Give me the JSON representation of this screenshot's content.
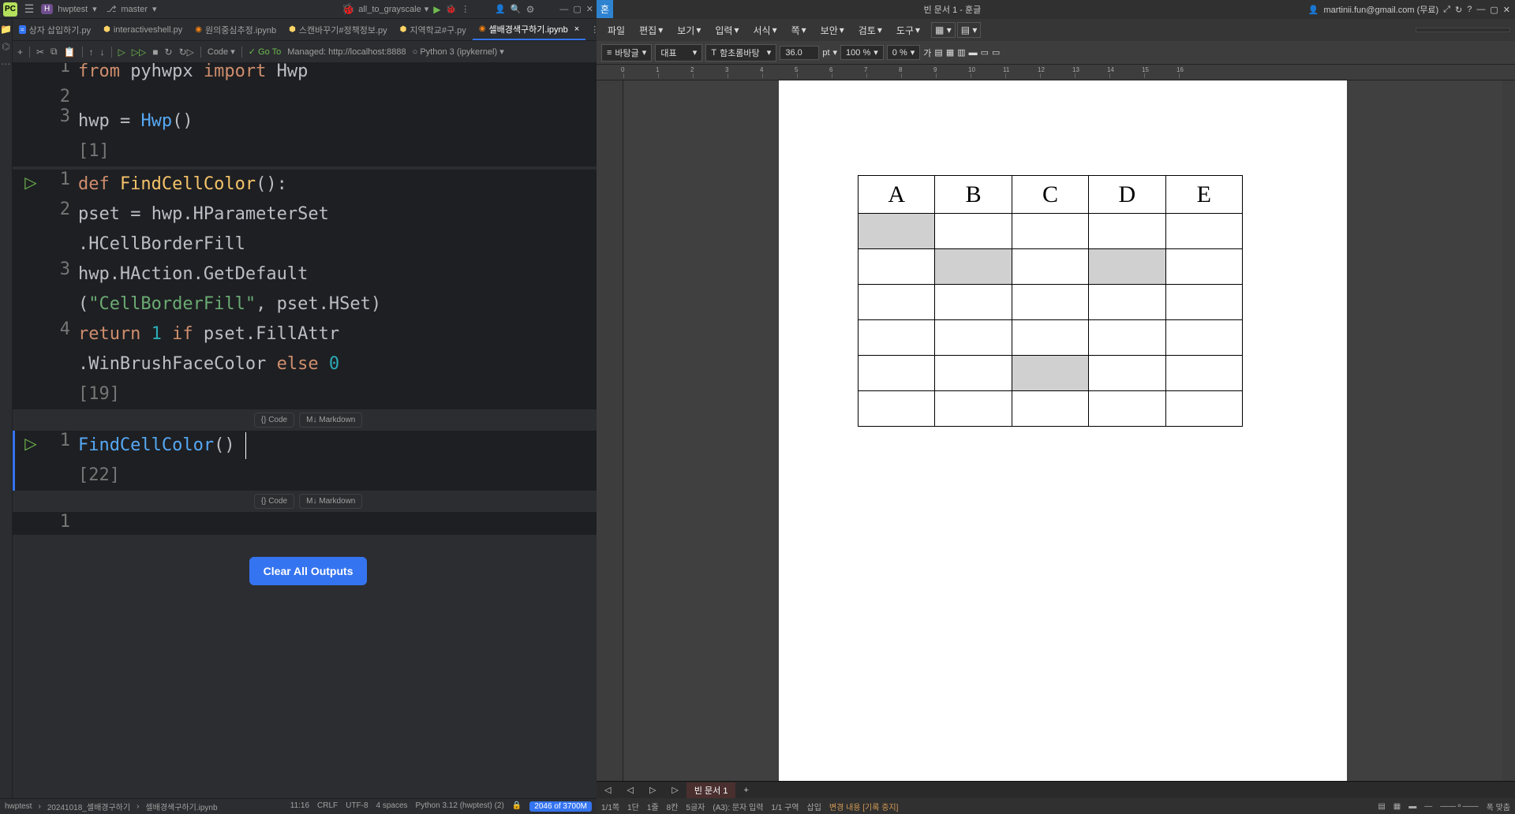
{
  "pycharm": {
    "project": "hwptest",
    "branch": "master",
    "config": "all_to_grayscale",
    "tabs": [
      {
        "label": "상자 삽입하기.py",
        "icon": "blue"
      },
      {
        "label": "interactiveshell.py",
        "icon": "py"
      },
      {
        "label": "원의중심추정.ipynb",
        "icon": "jp"
      },
      {
        "label": "스캔바꾸기#정책정보.py",
        "icon": "py"
      },
      {
        "label": "지역학교#구.py",
        "icon": "py"
      },
      {
        "label": "셀배경색구하기.ipynb",
        "icon": "jp",
        "active": true
      }
    ],
    "toolbar": {
      "code": "Code",
      "goto": "Go To",
      "managed": "Managed: http://localhost:8888",
      "kernel": "Python 3 (ipykernel)"
    },
    "cells": [
      {
        "exec": "[1]",
        "lines": [
          {
            "n": "1",
            "frag": [
              {
                "t": "from ",
                "c": "kw"
              },
              {
                "t": "pyhwpx ",
                "c": "id"
              },
              {
                "t": "import ",
                "c": "kw"
              },
              {
                "t": "Hwp",
                "c": "id"
              }
            ]
          },
          {
            "n": "2",
            "frag": []
          },
          {
            "n": "3",
            "frag": [
              {
                "t": "hwp ",
                "c": "id"
              },
              {
                "t": "= ",
                "c": "op"
              },
              {
                "t": "Hwp",
                "c": "fn"
              },
              {
                "t": "()",
                "c": "op"
              }
            ]
          }
        ]
      },
      {
        "exec": "[19]",
        "run": true,
        "lines": [
          {
            "n": "1",
            "frag": [
              {
                "t": "def ",
                "c": "kw"
              },
              {
                "t": "FindCellColor",
                "c": "fname"
              },
              {
                "t": "():",
                "c": "op"
              }
            ]
          },
          {
            "n": "2",
            "frag": [
              {
                "t": "    pset ",
                "c": "id"
              },
              {
                "t": "= ",
                "c": "op"
              },
              {
                "t": "hwp.HParameterSet",
                "c": "id"
              }
            ]
          },
          {
            "n": "",
            "frag": [
              {
                "t": "      .HCellBorderFill",
                "c": "id"
              }
            ]
          },
          {
            "n": "3",
            "frag": [
              {
                "t": "    hwp.HAction.GetDefault",
                "c": "id"
              }
            ]
          },
          {
            "n": "",
            "frag": [
              {
                "t": "      (",
                "c": "op"
              },
              {
                "t": "\"CellBorderFill\"",
                "c": "str"
              },
              {
                "t": ", pset.HSet)",
                "c": "id"
              }
            ]
          },
          {
            "n": "4",
            "frag": [
              {
                "t": "    ",
                "c": "id"
              },
              {
                "t": "return ",
                "c": "kw"
              },
              {
                "t": "1 ",
                "c": "num"
              },
              {
                "t": "if ",
                "c": "kw"
              },
              {
                "t": "pset.FillAttr",
                "c": "id"
              }
            ]
          },
          {
            "n": "",
            "frag": [
              {
                "t": "      .WinBrushFaceColor ",
                "c": "id"
              },
              {
                "t": "else ",
                "c": "kw"
              },
              {
                "t": "0",
                "c": "num"
              }
            ]
          }
        ]
      },
      {
        "exec": "[22]",
        "run": true,
        "focused": true,
        "lines": [
          {
            "n": "1",
            "frag": [
              {
                "t": "FindCellColor",
                "c": "fn"
              },
              {
                "t": "()",
                "c": "op"
              }
            ]
          }
        ]
      },
      {
        "exec": "",
        "lines": [
          {
            "n": "1",
            "frag": []
          }
        ]
      }
    ],
    "addcell": {
      "code": "Code",
      "markdown": "Markdown"
    },
    "clear": "Clear All Outputs",
    "status": {
      "path1": "hwptest",
      "path2": "20241018_셀배경구하기",
      "path3": "셀배경색구하기.ipynb",
      "pos": "11:16",
      "eol": "CRLF",
      "enc": "UTF-8",
      "indent": "4 spaces",
      "py": "Python 3.12 (hwptest) (2)",
      "mem": "2046 of 3700M"
    }
  },
  "hancom": {
    "title": "빈 문서 1 - 훈글",
    "user": "martinii.fun@gmail.com (무료)",
    "menu": [
      "파일",
      "편집",
      "보기",
      "입력",
      "서식",
      "쪽",
      "보안",
      "검토",
      "도구"
    ],
    "format": {
      "style": "바탕글",
      "para": "대표",
      "font": "함초롬바탕",
      "size": "36.0",
      "unit": "pt",
      "zoom": "100 %",
      "spacing": "0 %",
      "g": "가"
    },
    "table": {
      "headers": [
        "A",
        "B",
        "C",
        "D",
        "E"
      ],
      "rows": [
        [
          true,
          false,
          false,
          false,
          false
        ],
        [
          false,
          true,
          false,
          true,
          false
        ],
        [
          false,
          false,
          false,
          false,
          false
        ],
        [
          false,
          false,
          false,
          false,
          false
        ],
        [
          false,
          false,
          true,
          false,
          false
        ],
        [
          false,
          false,
          false,
          false,
          false
        ]
      ]
    },
    "bottomtab": "빈 문서 1",
    "status": {
      "page": "1/1쪽",
      "dan": "1단",
      "line": "1줄",
      "col": "8칸",
      "chars": "5글자",
      "cell": "(A3): 문자 입력",
      "sec": "1/1 구역",
      "mode": "삽입",
      "rec": "변경 내용 [기록 중지]"
    }
  }
}
